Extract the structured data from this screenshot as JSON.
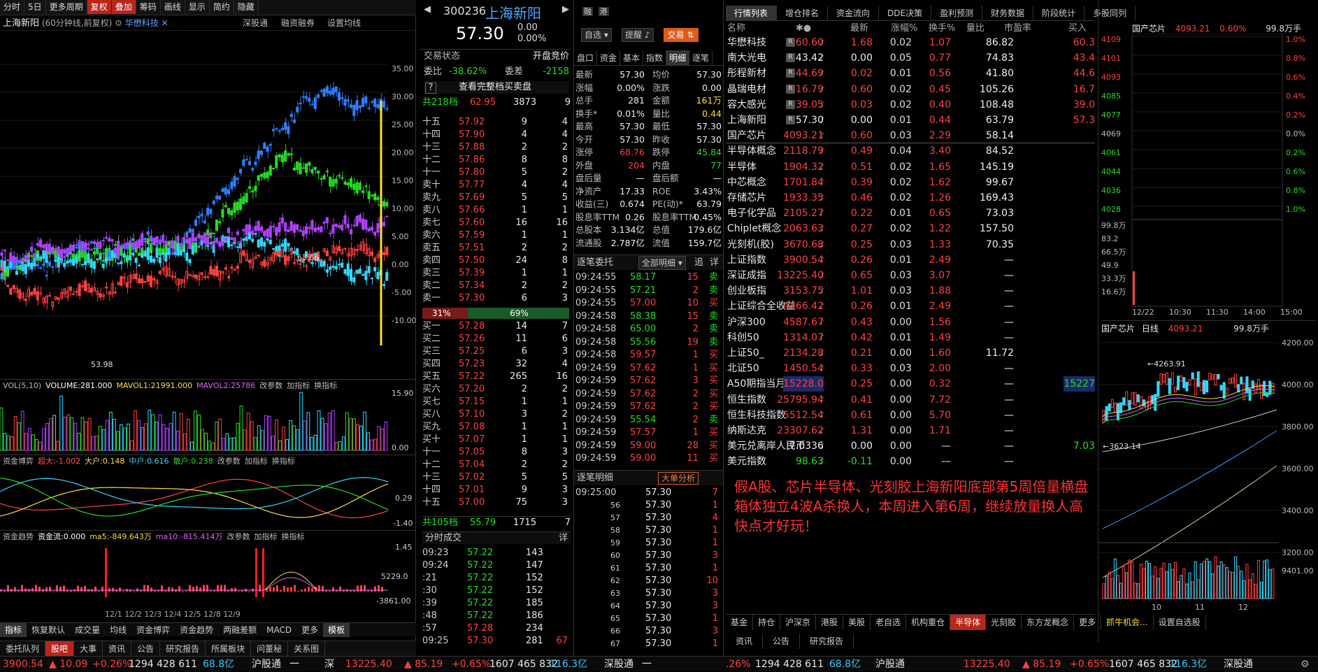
{
  "toolbar": {
    "items": [
      "分时",
      "5日",
      "更多周期",
      "复权",
      "叠加",
      "筹码",
      "画线",
      "显示",
      "简约",
      "隐藏"
    ]
  },
  "chart": {
    "title": "上海新阳",
    "subtitle": "(60分钟线,前复权)",
    "compare": "华懋科技",
    "links": [
      "深股通",
      "融资融券",
      "设置均线"
    ],
    "price_labels": [
      "35.00",
      "30.00",
      "25.00",
      "20.00",
      "15.00",
      "10.00",
      "5.00",
      "0.00",
      "-5.00",
      "-10.00"
    ],
    "high_mark": "63.66",
    "low_mark": "53.98",
    "vol": {
      "title": "VOL(5,10)",
      "v": "VOLUME:281.000",
      "m1": "MAVOL1:21991.000",
      "m2": "MAVOL2:25786",
      "btns": [
        "改参数",
        "加指标",
        "换指标"
      ],
      "ticks": [
        "15.90",
        "0.00"
      ]
    },
    "fund": {
      "title": "资金博弈",
      "a": "超大:-1.002",
      "b": "大户:0.148",
      "c": "中户:0.616",
      "d": "散户:0.238",
      "btns": [
        "改参数",
        "加指标",
        "换指标"
      ],
      "ticks": [
        "0.29",
        "-1.40"
      ]
    },
    "trend": {
      "title": "资金趋势",
      "a": "资金流:0.000",
      "b": "ma5:-849.643万",
      "c": "ma10:-815.414万",
      "btns": [
        "改参数",
        "加指标",
        "换指标"
      ],
      "ticks": [
        "1.45",
        "5229.0",
        "-3861.00"
      ]
    },
    "dates": "12/1 12/2 12/3 12/4 12/5 12/8 12/9",
    "tabs": [
      "指标",
      "恢复默认",
      "成交量",
      "均线",
      "资金博弈",
      "资金趋势",
      "两融差额",
      "MACD",
      "更多",
      "模板"
    ]
  },
  "quote": {
    "code": "300236",
    "name": "上海新阳",
    "price": "57.30",
    "chg": "0.00",
    "pct": "0.00%",
    "btn_zx": "自选",
    "btn_tx": "提醒",
    "btn_jy": "交易",
    "state_label": "交易状态",
    "state": "开盘竞价",
    "wb_label": "委比",
    "wb": "-38.62%",
    "wc_label": "委差",
    "wc": "-2158",
    "full": "查看完整档买卖盘",
    "sell_total": [
      "共218档",
      "62.95",
      "3873",
      "9"
    ],
    "buy_total": [
      "共105档",
      "55.79",
      "1715",
      "7"
    ],
    "ratio_l": "31%",
    "ratio_r": "69%"
  },
  "asks": [
    [
      "十五",
      "57.92",
      "9",
      "4"
    ],
    [
      "十四",
      "57.90",
      "4",
      "4"
    ],
    [
      "十三",
      "57.88",
      "2",
      "2"
    ],
    [
      "十二",
      "57.86",
      "8",
      "8"
    ],
    [
      "十一",
      "57.80",
      "5",
      "2"
    ],
    [
      "卖十",
      "57.77",
      "4",
      "4"
    ],
    [
      "卖九",
      "57.69",
      "5",
      "5"
    ],
    [
      "卖八",
      "57.66",
      "1",
      "1"
    ],
    [
      "卖七",
      "57.60",
      "16",
      "16"
    ],
    [
      "卖六",
      "57.59",
      "1",
      "1"
    ],
    [
      "卖五",
      "57.51",
      "2",
      "2"
    ],
    [
      "卖四",
      "57.50",
      "24",
      "8"
    ],
    [
      "卖三",
      "57.39",
      "1",
      "1"
    ],
    [
      "卖二",
      "57.34",
      "2",
      "2"
    ],
    [
      "卖一",
      "57.30",
      "6",
      "3"
    ]
  ],
  "bids": [
    [
      "买一",
      "57.28",
      "14",
      "7"
    ],
    [
      "买二",
      "57.26",
      "11",
      "6"
    ],
    [
      "买三",
      "57.25",
      "6",
      "3"
    ],
    [
      "买四",
      "57.23",
      "32",
      "4"
    ],
    [
      "买五",
      "57.22",
      "265",
      "16"
    ],
    [
      "买六",
      "57.20",
      "2",
      "2"
    ],
    [
      "买七",
      "57.15",
      "1",
      "1"
    ],
    [
      "买八",
      "57.10",
      "3",
      "2"
    ],
    [
      "买九",
      "57.08",
      "1",
      "1"
    ],
    [
      "买十",
      "57.07",
      "1",
      "1"
    ],
    [
      "十一",
      "57.05",
      "8",
      "3"
    ],
    [
      "十二",
      "57.04",
      "2",
      "2"
    ],
    [
      "十三",
      "57.02",
      "5",
      "5"
    ],
    [
      "十四",
      "57.01",
      "9",
      "3"
    ],
    [
      "十五",
      "57.00",
      "75",
      "3"
    ]
  ],
  "ticks_title": "分时成交",
  "ticks": [
    [
      "09:23",
      "57.22",
      "143",
      ""
    ],
    [
      "09:24",
      "57.22",
      "147",
      ""
    ],
    [
      ":21",
      "57.22",
      "152",
      ""
    ],
    [
      ":30",
      "57.22",
      "152",
      ""
    ],
    [
      ":39",
      "57.22",
      "185",
      ""
    ],
    [
      ":48",
      "57.22",
      "186",
      ""
    ],
    [
      ":57",
      "57.28",
      "234",
      ""
    ],
    [
      "09:25",
      "57.30",
      "281",
      "67"
    ]
  ],
  "stats_tabs": [
    "盘口",
    "资金",
    "基本",
    "指数",
    "明细",
    "逐笔"
  ],
  "stats": [
    [
      "最新",
      "57.30",
      "均价",
      "57.30"
    ],
    [
      "涨幅",
      "0.00%",
      "涨跌",
      "0.00"
    ],
    [
      "总手",
      "281",
      "金额",
      "161万"
    ],
    [
      "换手*",
      "0.01%",
      "量比",
      "0.44"
    ],
    [
      "最高",
      "57.30",
      "最低",
      "57.30"
    ],
    [
      "今开",
      "57.30",
      "昨收",
      "57.30"
    ],
    [
      "涨停",
      "68.76",
      "跌停",
      "45.84"
    ],
    [
      "外盘",
      "204",
      "内盘",
      "77"
    ],
    [
      "盘后量",
      "—",
      "盘后额",
      "—"
    ],
    [
      "净资产",
      "17.33",
      "ROE",
      "3.43%"
    ],
    [
      "收益(三)",
      "0.674",
      "PE(动)*",
      "63.79"
    ],
    [
      "股息率TTM",
      "0.26",
      "股息率TTM",
      "0.45%"
    ],
    [
      "总股本",
      "3.134亿",
      "总值",
      "179.6亿"
    ],
    [
      "流通股",
      "2.787亿",
      "流值",
      "159.7亿"
    ]
  ],
  "orders_title": "逐笔委托",
  "orders_opt": "全部明细",
  "orders_btns": [
    "追",
    "详"
  ],
  "orders": [
    [
      "09:24:55",
      "58.17",
      "15",
      "卖"
    ],
    [
      "09:24:55",
      "57.21",
      "2",
      "卖"
    ],
    [
      "09:24:55",
      "57.00",
      "10",
      "买"
    ],
    [
      "09:24:58",
      "58.38",
      "15",
      "卖"
    ],
    [
      "09:24:58",
      "65.00",
      "2",
      "卖"
    ],
    [
      "09:24:58",
      "55.56",
      "19",
      "卖"
    ],
    [
      "09:24:58",
      "59.57",
      "1",
      "买"
    ],
    [
      "09:24:59",
      "57.62",
      "1",
      "买"
    ],
    [
      "09:24:59",
      "57.62",
      "3",
      "买"
    ],
    [
      "09:24:59",
      "57.62",
      "2",
      "买"
    ],
    [
      "09:24:59",
      "57.62",
      "2",
      "买"
    ],
    [
      "09:24:59",
      "55.54",
      "2",
      "卖"
    ],
    [
      "09:24:59",
      "57.57",
      "1",
      "买"
    ],
    [
      "09:24:59",
      "59.00",
      "28",
      "买"
    ],
    [
      "09:24:59",
      "59.00",
      "11",
      "买"
    ]
  ],
  "details_title": "逐笔明细",
  "details_btn": "大单分析",
  "details": [
    [
      "09:25:00",
      "57.30",
      "7"
    ],
    [
      "56",
      "57.30",
      "1"
    ],
    [
      "57",
      "57.30",
      "4"
    ],
    [
      "58",
      "57.30",
      "1"
    ],
    [
      "59",
      "57.30",
      "1"
    ],
    [
      "60",
      "57.30",
      "3"
    ],
    [
      "61",
      "57.30",
      "1"
    ],
    [
      "62",
      "57.30",
      "10"
    ],
    [
      "63",
      "57.30",
      "3"
    ],
    [
      "64",
      "57.30",
      "3"
    ],
    [
      "65",
      "57.30",
      "1"
    ],
    [
      "66",
      "57.30",
      "3"
    ],
    [
      "67",
      "57.30",
      "1"
    ]
  ],
  "market_tabs": [
    "行情列表",
    "增仓排名",
    "资金流向",
    "DDE决策",
    "盈利预测",
    "财务数据",
    "阶段统计",
    "多股同列"
  ],
  "market_head": [
    "名称",
    "最新",
    "涨幅%",
    "换手%",
    "量比",
    "市盈率",
    "买入"
  ],
  "market": [
    [
      "华懋科技",
      "60.60",
      "1.68",
      "0.02",
      "1.07",
      "86.82",
      "60.3"
    ],
    [
      "南大光电",
      "43.42",
      "0.00",
      "0.05",
      "0.77",
      "74.83",
      "43.4"
    ],
    [
      "彤程新材",
      "44.69",
      "0.02",
      "0.01",
      "0.56",
      "41.80",
      "44.6"
    ],
    [
      "晶瑞电材",
      "16.79",
      "0.60",
      "0.02",
      "0.45",
      "105.26",
      "16.7"
    ],
    [
      "容大感光",
      "39.05",
      "0.03",
      "0.02",
      "0.40",
      "108.48",
      "39.0"
    ],
    [
      "上海新阳",
      "57.30",
      "0.00",
      "0.01",
      "0.44",
      "63.79",
      "57.3"
    ],
    [
      "国产芯片",
      "4093.21",
      "0.60",
      "0.03",
      "2.29",
      "58.14",
      ""
    ],
    [
      "半导体概念",
      "2118.79",
      "0.49",
      "0.04",
      "3.40",
      "84.52",
      ""
    ],
    [
      "半导体",
      "1904.32",
      "0.51",
      "0.02",
      "1.65",
      "145.19",
      ""
    ],
    [
      "中芯概念",
      "1701.84",
      "0.39",
      "0.02",
      "1.62",
      "99.67",
      ""
    ],
    [
      "存储芯片",
      "1933.35",
      "0.46",
      "0.02",
      "1.26",
      "169.43",
      ""
    ],
    [
      "电子化学品",
      "2105.27",
      "0.22",
      "0.01",
      "0.65",
      "73.03",
      ""
    ],
    [
      "Chiplet概念",
      "2063.63",
      "0.27",
      "0.02",
      "1.22",
      "157.50",
      ""
    ],
    [
      "光刻机(胶)",
      "3670.68",
      "0.25",
      "0.03",
      "1.33",
      "70.35",
      ""
    ],
    [
      "上证指数",
      "3900.54",
      "0.26",
      "0.01",
      "2.49",
      "—",
      ""
    ],
    [
      "深证成指",
      "13225.40",
      "0.65",
      "0.03",
      "3.07",
      "—",
      ""
    ],
    [
      "创业板指",
      "3153.75",
      "1.01",
      "0.03",
      "1.88",
      "—",
      ""
    ],
    [
      "上证综合全收益",
      "4466.42",
      "0.26",
      "0.01",
      "2.49",
      "—",
      ""
    ],
    [
      "沪深300",
      "4587.67",
      "0.43",
      "0.00",
      "1.56",
      "—",
      ""
    ],
    [
      "科创50",
      "1314.07",
      "0.42",
      "0.01",
      "1.49",
      "—",
      ""
    ],
    [
      "上证50_",
      "2134.28",
      "0.21",
      "0.00",
      "1.60",
      "11.72",
      ""
    ],
    [
      "北证50",
      "1450.54",
      "0.33",
      "0.03",
      "2.00",
      "—",
      ""
    ],
    [
      "A50期指当月连续",
      "15228.0",
      "0.25",
      "0.00",
      "0.32",
      "—",
      "15227"
    ],
    [
      "恒生指数",
      "25795.94",
      "0.41",
      "0.00",
      "7.72",
      "—",
      ""
    ],
    [
      "恒生科技指数",
      "5512.54",
      "0.61",
      "0.00",
      "5.70",
      "—",
      ""
    ],
    [
      "纳斯达克",
      "23307.62",
      "1.31",
      "0.00",
      "1.71",
      "—",
      ""
    ],
    [
      "美元兑离岸人民币",
      "7.0336",
      "0.00",
      "0.00",
      "—",
      "—",
      "7.03"
    ],
    [
      "美元指数",
      "98.63",
      "-0.11",
      "0.00",
      "—",
      "—",
      ""
    ]
  ],
  "note": "假A股、芯片半导体、光刻胶上海新阳底部第5周倍量横盘箱体独立4波A杀换人，本周进入第6周，继续放量换人高快点才好玩！",
  "bottom_tabs": [
    "基金",
    "持仓",
    "沪深京",
    "港股",
    "美股",
    "老自选",
    "机构重仓",
    "半导体",
    "光刻胶",
    "东方龙概念",
    "更多",
    "抓牛机会...",
    "设置自选股"
  ],
  "mini1": {
    "name": "国产芯片",
    "price": "4093.21",
    "pct": "0.60%",
    "amt": "99.8万手",
    "left": [
      "4109",
      "4101",
      "4093",
      "4085",
      "4077",
      "4069",
      "4061",
      "4044",
      "4036",
      "4028"
    ],
    "right": [
      "1.0%",
      "0.8%",
      "0.6%",
      "0.4%",
      "0.2%",
      "0.0%",
      "0.2%",
      "0.6%",
      "0.8%",
      "1.0%"
    ],
    "vol": [
      "99.8万",
      "83.2",
      "66.5万",
      "49.9",
      "33.3万",
      "16.6万"
    ],
    "times": [
      "12/22",
      "10:30",
      "11:30",
      "14:00",
      "15:00"
    ]
  },
  "mini2": {
    "name": "国产芯片",
    "type": "日线",
    "price": "4093.21",
    "amt": "99.8万手",
    "hi": "4263.91",
    "lo": "3623.14",
    "ticks": [
      "4200.00",
      "4000.00",
      "3800.00",
      "3600.00",
      "3400.00",
      "3200.00"
    ],
    "vtick": "9401.00",
    "dates": [
      "10",
      "11",
      "12"
    ]
  },
  "info_tabs": [
    "资讯",
    "公告",
    "研究报告"
  ],
  "left_bottom_tabs": [
    "委托队列",
    "股吧",
    "大事",
    "资讯",
    "公告",
    "研究报告",
    "所属板块",
    "问董秘",
    "关系图"
  ],
  "status": {
    "sh": "3900.54",
    "sh_chg": "▲ 10.09",
    "sh_pct": "+0.26%",
    "sh_n": "1294 428 611",
    "sh_amt": "68.8亿",
    "hgt": "沪股通",
    "sz_lbl": "深",
    "sz": "13225.40",
    "sz_chg": "▲ 85.19",
    "sz_pct": "+0.65%",
    "sz_n": "1607 465 832",
    "sz_amt": "116.3亿",
    "sgt": "深股通",
    "r_pct": ".26%",
    "r_n": "1294 428 611",
    "r_amt": "68.8亿",
    "r_hgt": "沪股通",
    "r_sz": "13225.40",
    "r_chg": "▲ 85.19",
    "r_pct2": "+0.65%",
    "r_n2": "1607 465 832",
    "r_amt2": "116.3亿",
    "r_sgt": "深股通"
  },
  "colors": {
    "up": "#ff4040",
    "down": "#22dd22",
    "accent": "#b8261c",
    "blue": "#2a7fff",
    "cyan": "#30d8ff",
    "yellow": "#ffdd33",
    "purple": "#b040ff"
  }
}
